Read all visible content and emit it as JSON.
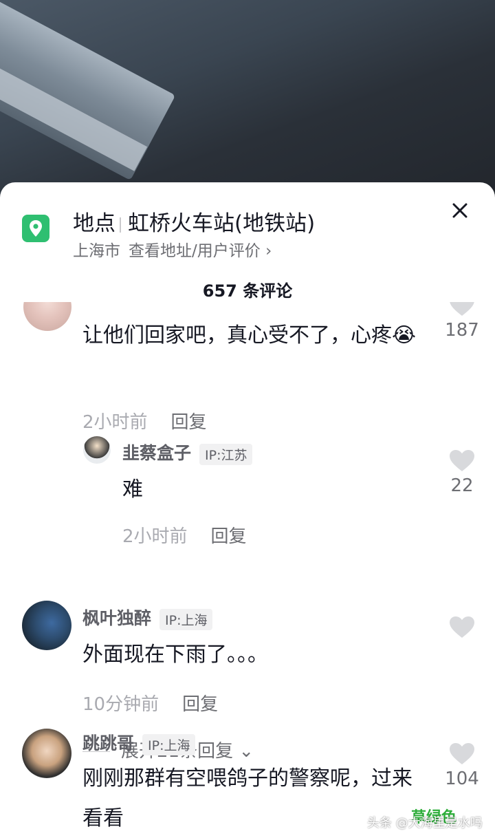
{
  "location": {
    "label": "地点",
    "name": "虹桥火车站(地铁站)",
    "city": "上海市",
    "address_link": "查看地址/用户评价",
    "pin_color": "#2fbf71"
  },
  "comments_count": "657 条评论",
  "comments": [
    {
      "text": "让他们回家吧，真心受不了，心疼😭",
      "time": "2小时前",
      "reply_label": "回复",
      "likes": "187",
      "replies": [
        {
          "username": "韭蔡盒子",
          "ip": "IP:江苏",
          "text": "难",
          "time": "2小时前",
          "reply_label": "回复",
          "likes": "22"
        }
      ],
      "expand_label": "展开21条回复"
    },
    {
      "username": "枫叶独醉",
      "ip": "IP:上海",
      "text": "外面现在下雨了。。。",
      "time": "10分钟前",
      "reply_label": "回复",
      "likes": ""
    },
    {
      "username": "跳跳哥",
      "ip": "IP:上海",
      "text": "刚刚那群有空喂鸽子的警察呢，过来看看",
      "likes": "104"
    }
  ],
  "watermark": {
    "source": "头条 @大海里是水吗",
    "overlay": "草绿色"
  }
}
